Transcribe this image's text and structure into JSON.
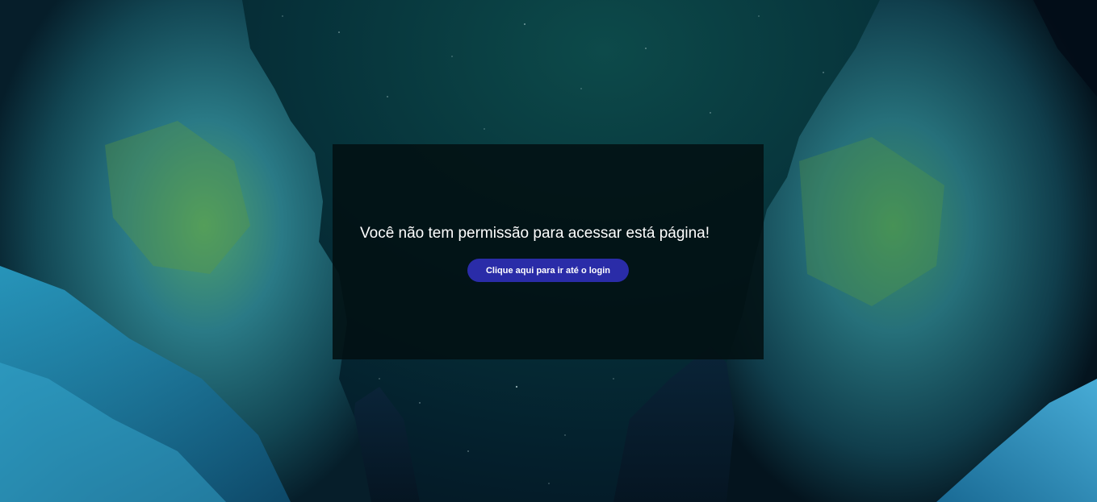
{
  "background": {
    "description_icon": "canyon-night-sky-background",
    "sky_color": "#06323a",
    "rock_color_left": "#1b6e7c",
    "rock_color_right": "#1a5a66",
    "moss_color": "#5a9a3a"
  },
  "panel": {
    "message": "Você não tem permissão para acessar está página!",
    "button_label": "Clique aqui para ir até o login",
    "button_color": "#2a2ca8",
    "panel_color": "#021012"
  }
}
